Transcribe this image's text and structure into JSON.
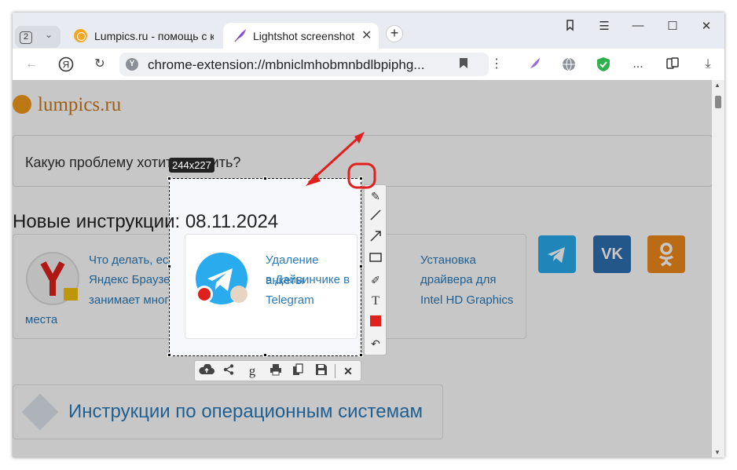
{
  "tabs": {
    "count": "2",
    "tab1_title": "Lumpics.ru - помощь с компьютером",
    "tab2_title": "Lightshot screenshot"
  },
  "window": {
    "bookmarks_icon": "bookmarks-icon",
    "menu_icon": "hamburger-icon",
    "minimize_icon": "minimize-icon",
    "maximize_icon": "maximize-icon",
    "close_icon": "close-icon"
  },
  "toolbar": {
    "url": "chrome-extension://mbniclmhobmnbdlbpiphg...",
    "more": "⋮",
    "ext_more": "..."
  },
  "page": {
    "logo": "lumpics.ru",
    "search_placeholder": "Какую проблему хотите решить?",
    "heading": "Новые инструкции: 08.11.2024",
    "card1_line1": "Что делать, если",
    "card1_line2": "Яндекс Браузер",
    "card1_line3": "занимает много",
    "card1_line4": "места",
    "card2_line1": "Удаление анкеты",
    "card2_line2": "в Дайвинчике в",
    "card2_line3": "Telegram",
    "card3_line1": "Установка",
    "card3_line2": "драйвера для",
    "card3_line3": "Intel HD Graphics",
    "os_title": "Инструкции по операционным системам"
  },
  "lightshot": {
    "size_label": "244x227"
  },
  "colors": {
    "accent_red": "#e0201c",
    "link_blue": "#2a7ab8",
    "telegram": "#2aabee",
    "vk": "#2d6fb0",
    "ok": "#f08a1a"
  }
}
